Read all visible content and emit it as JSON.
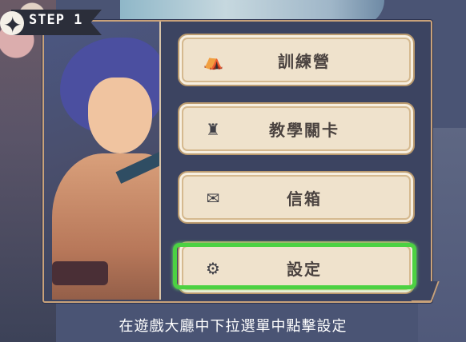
{
  "step": {
    "label": "STEP 1",
    "icon": "diamond-star-icon"
  },
  "menu": {
    "items": [
      {
        "label": "訓練營",
        "icon": "camp-icon"
      },
      {
        "label": "教學關卡",
        "icon": "castle-icon"
      },
      {
        "label": "信箱",
        "icon": "mail-icon"
      },
      {
        "label": "設定",
        "icon": "gear-icon",
        "highlighted": true
      }
    ]
  },
  "caption": "在遊戲大廳中下拉選單中點擊設定",
  "colors": {
    "highlight": "#4cd142",
    "button_bg": "#efe2cc",
    "panel_bg": "#3c4461",
    "badge_bg": "#2b2e3a"
  }
}
